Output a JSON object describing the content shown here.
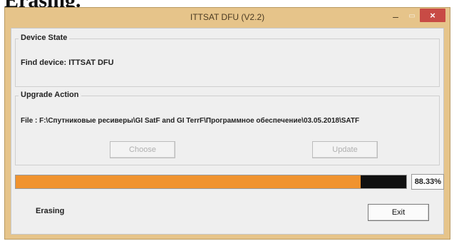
{
  "caption": "Erasing.",
  "window": {
    "title": "ITTSAT DFU (V2.2)"
  },
  "titlebar": {
    "min_glyph": "–",
    "max_glyph": "▭",
    "close_glyph": "×"
  },
  "device_state": {
    "title": "Device State",
    "find_device_text": "Find device: ITTSAT DFU"
  },
  "upgrade_action": {
    "title": "Upgrade Action",
    "file_text": "File :  F:\\Спутниковые ресиверы\\GI SatF and GI TerrF\\Программное обеспечение\\03.05.2018\\SATF",
    "choose_label": "Choose",
    "update_label": "Update"
  },
  "progress": {
    "value": 0.8833,
    "percent_text": "88.33%"
  },
  "status": {
    "text": "Erasing"
  },
  "exit_label": "Exit",
  "colors": {
    "window_frame": "#e6c48a",
    "close_button": "#c84b45",
    "progress_fill": "#f0932f",
    "progress_track": "#101010"
  }
}
